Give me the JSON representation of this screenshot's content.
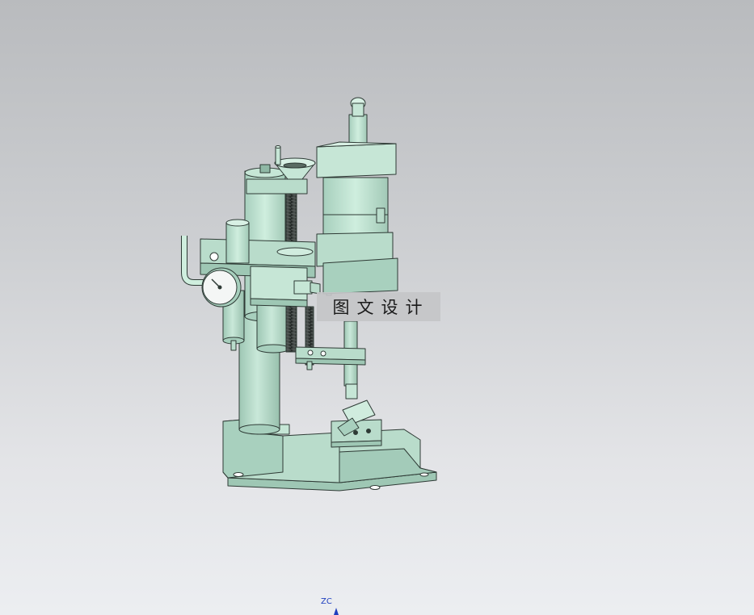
{
  "viewport": {
    "background_top": "#b9bbbe",
    "background_bottom": "#eceef1"
  },
  "model": {
    "body_color": "#b9dccb",
    "shade_color": "#9ec7b4",
    "edge_color": "#2e3a35",
    "screw_color": "#2b2f2d"
  },
  "watermark": {
    "text": "图文设计"
  },
  "triad": {
    "z_label": "ZC",
    "color": "#1f3fbf"
  }
}
